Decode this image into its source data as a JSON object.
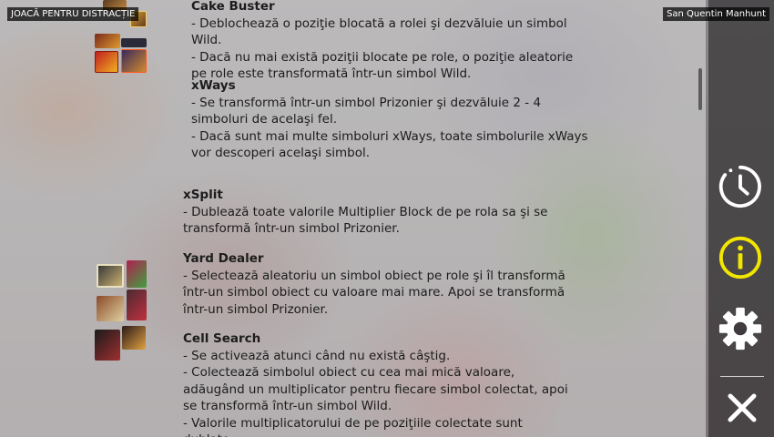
{
  "topbar": {
    "mode_label": "JOACĂ PENTRU DISTRACȚIE",
    "game_title": "San Quentin Manhunt"
  },
  "content": {
    "cake_buster": {
      "title": "Cake Buster",
      "line1": "- Deblochează o poziţie blocată a rolei şi dezvăluie un simbol Wild.",
      "line2": "- Dacă nu mai există poziţii blocate pe role, o poziţie aleatorie pe role este transformată într-un simbol Wild."
    },
    "xways": {
      "title": "xWays",
      "line1": "- Se transformă într-un simbol Prizonier şi dezvăluie 2 - 4 simboluri de acelaşi fel.",
      "line2": "- Dacă sunt mai multe simboluri xWays, toate simbolurile xWays vor descoperi acelaşi simbol."
    },
    "xsplit": {
      "title": "xSplit",
      "line1": "- Dublează toate valorile Multiplier Block de pe rola sa şi se transformă într-un simbol Prizonier."
    },
    "yard_dealer": {
      "title": "Yard Dealer",
      "line1": "- Selectează aleatoriu un simbol obiect pe role şi îl transformă într-un simbol obiect cu valoare mai mare. Apoi se transformă într-un simbol Prizonier."
    },
    "cell_search": {
      "title": "Cell Search",
      "line1": "- Se activează atunci când nu există câştig.",
      "line2": "- Colectează simbolul obiect cu cea mai mică valoare, adăugând un multiplicator pentru fiecare simbol colectat, apoi se transformă într-un simbol Wild.",
      "line3": "- Valorile multiplicatorului de pe poziţiile colectate sunt dublate."
    }
  },
  "rail": {
    "history_icon": "clock-history-icon",
    "info_icon": "info-icon",
    "settings_icon": "gear-icon",
    "close_icon": "close-icon",
    "info_active_color": "#f2e600"
  }
}
